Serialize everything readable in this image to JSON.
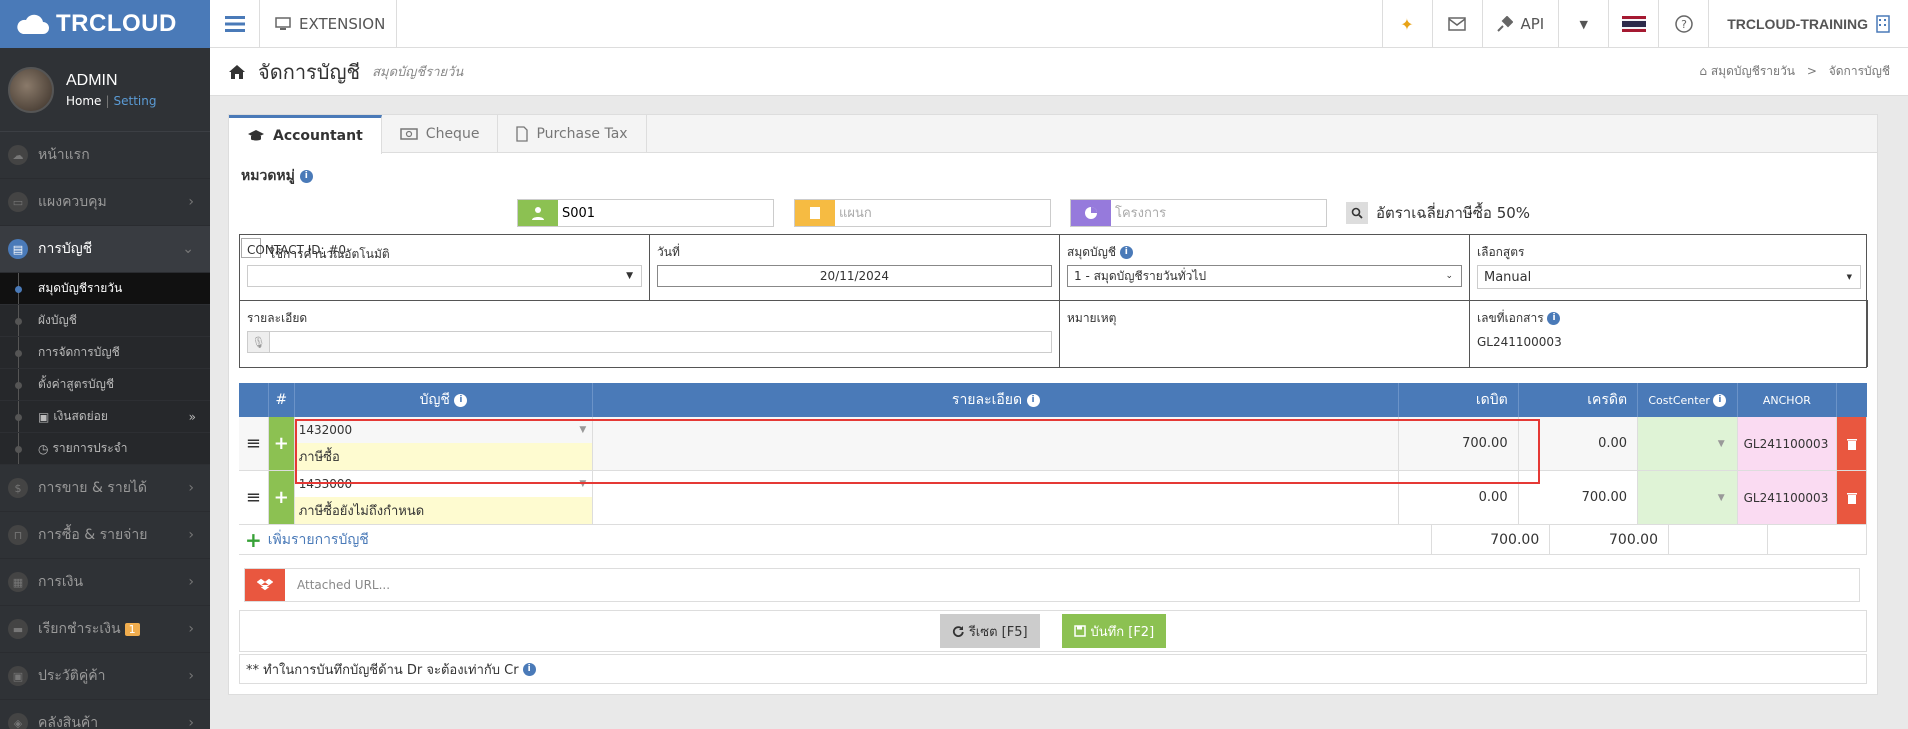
{
  "topbar": {
    "brand": "TRCLOUD",
    "extension_label": "EXTENSION",
    "api_label": "API",
    "user_label": "TRCLOUD-TRAINING"
  },
  "sidebar": {
    "profile_name": "ADMIN",
    "home_link": "Home",
    "separator": "|",
    "setting_link": "Setting",
    "items": [
      {
        "label": "หน้าแรก"
      },
      {
        "label": "แผงควบคุม"
      },
      {
        "label": "การบัญชี"
      },
      {
        "label": "การขาย & รายได้"
      },
      {
        "label": "การซื้อ & รายจ่าย"
      },
      {
        "label": "การเงิน"
      },
      {
        "label": "เรียกชำระเงิน",
        "badge": "1"
      },
      {
        "label": "ประวัติคู่ค้า"
      },
      {
        "label": "คลังสินค้า"
      }
    ],
    "subitems": [
      {
        "label": "สมุดบัญชีรายวัน"
      },
      {
        "label": "ผังบัญชี"
      },
      {
        "label": "การจัดการบัญชี"
      },
      {
        "label": "ตั้งค่าสูตรบัญชี"
      },
      {
        "label": "เงินสดย่อย"
      },
      {
        "label": "รายการประจำ"
      }
    ]
  },
  "header": {
    "title": "จัดการบัญชี",
    "subtitle": "สมุดบัญชีรายวัน",
    "breadcrumb": [
      "สมุดบัญชีรายวัน",
      "จัดการบัญชี"
    ],
    "breadcrumb_sep": ">"
  },
  "tabs": [
    {
      "label": "Accountant"
    },
    {
      "label": "Cheque"
    },
    {
      "label": "Purchase Tax"
    }
  ],
  "filters": {
    "group_label": "หมวดหมู่",
    "auto_calc_label": "ใช้การคำนวณอัตโนมัติ",
    "code_value": "S001",
    "dept_placeholder": "แผนก",
    "project_placeholder": "โครงการ",
    "tax_rate_text": "อัตราเฉลี่ยภาษีซื้อ 50%"
  },
  "header_fields": {
    "contact_label": "CONTACT ID: #0",
    "contact_value": "",
    "date_label": "วันที่",
    "date_value": "20/11/2024",
    "book_label": "สมุดบัญชี",
    "book_value": "1 - สมุดบัญชีรายวันทั่วไป",
    "formula_label": "เลือกสูตร",
    "formula_value": "Manual",
    "detail_label": "รายละเอียด",
    "remark_label": "หมายเหตุ",
    "docno_label": "เลขที่เอกสาร",
    "docno_value": "GL241100003"
  },
  "lines": {
    "headers": {
      "hash": "#",
      "account": "บัญชี",
      "detail": "รายละเอียด",
      "debit": "เดบิต",
      "credit": "เครดิต",
      "cost_center": "CostCenter",
      "anchor": "ANCHOR"
    },
    "rows": [
      {
        "code": "1432000",
        "name": "ภาษีซื้อ",
        "detail": "",
        "debit": "700.00",
        "credit": "0.00",
        "anchor": "GL241100003"
      },
      {
        "code": "1433000",
        "name": "ภาษีซื้อยังไม่ถึงกำหนด",
        "detail": "",
        "debit": "0.00",
        "credit": "700.00",
        "anchor": "GL241100003"
      }
    ],
    "add_line_label": "เพิ่มรายการบัญชี",
    "total_debit": "700.00",
    "total_credit": "700.00"
  },
  "attach": {
    "placeholder": "Attached URL..."
  },
  "actions": {
    "reset_label": "รีเซต [F5]",
    "save_label": "บันทึก [F2]"
  },
  "note": {
    "text": "** ทำในการบันทึกบัญชีด้าน Dr จะต้องเท่ากับ Cr"
  },
  "colors": {
    "brand": "#4a7ab8",
    "green": "#8cc152",
    "red": "#e9573f",
    "highlight": "#e53935"
  }
}
